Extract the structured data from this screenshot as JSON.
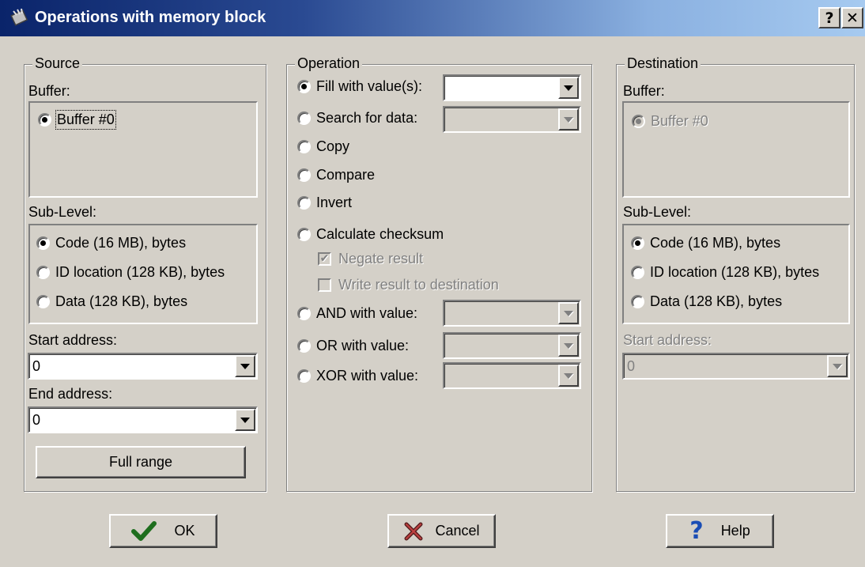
{
  "window": {
    "title": "Operations with memory block",
    "help_button": "?",
    "close_button": "✕"
  },
  "source": {
    "legend": "Source",
    "buffer_label": "Buffer:",
    "buffer_option": "Buffer #0",
    "sublevel_label": "Sub-Level:",
    "sublevels": [
      "Code (16 MB), bytes",
      "ID location (128 KB), bytes",
      "Data (128 KB), bytes"
    ],
    "selected_sublevel": 0,
    "start_label": "Start address:",
    "start_value": "0",
    "end_label": "End address:",
    "end_value": "0",
    "full_range_button": "Full range"
  },
  "operation": {
    "legend": "Operation",
    "fill_label": "Fill with value(s):",
    "search_label": "Search for data:",
    "copy_label": "Copy",
    "compare_label": "Compare",
    "invert_label": "Invert",
    "checksum_label": "Calculate checksum",
    "negate_label": "Negate result",
    "negate_checked": true,
    "write_label": "Write result to destination",
    "write_checked": false,
    "and_label": "AND with value:",
    "or_label": "OR with value:",
    "xor_label": "XOR with value:",
    "selected": "fill"
  },
  "destination": {
    "legend": "Destination",
    "buffer_label": "Buffer:",
    "buffer_option": "Buffer #0",
    "sublevel_label": "Sub-Level:",
    "sublevels": [
      "Code (16 MB), bytes",
      "ID location (128 KB), bytes",
      "Data (128 KB), bytes"
    ],
    "selected_sublevel": 0,
    "start_label": "Start address:",
    "start_value": "0"
  },
  "footer": {
    "ok": "OK",
    "cancel": "Cancel",
    "help": "Help"
  }
}
